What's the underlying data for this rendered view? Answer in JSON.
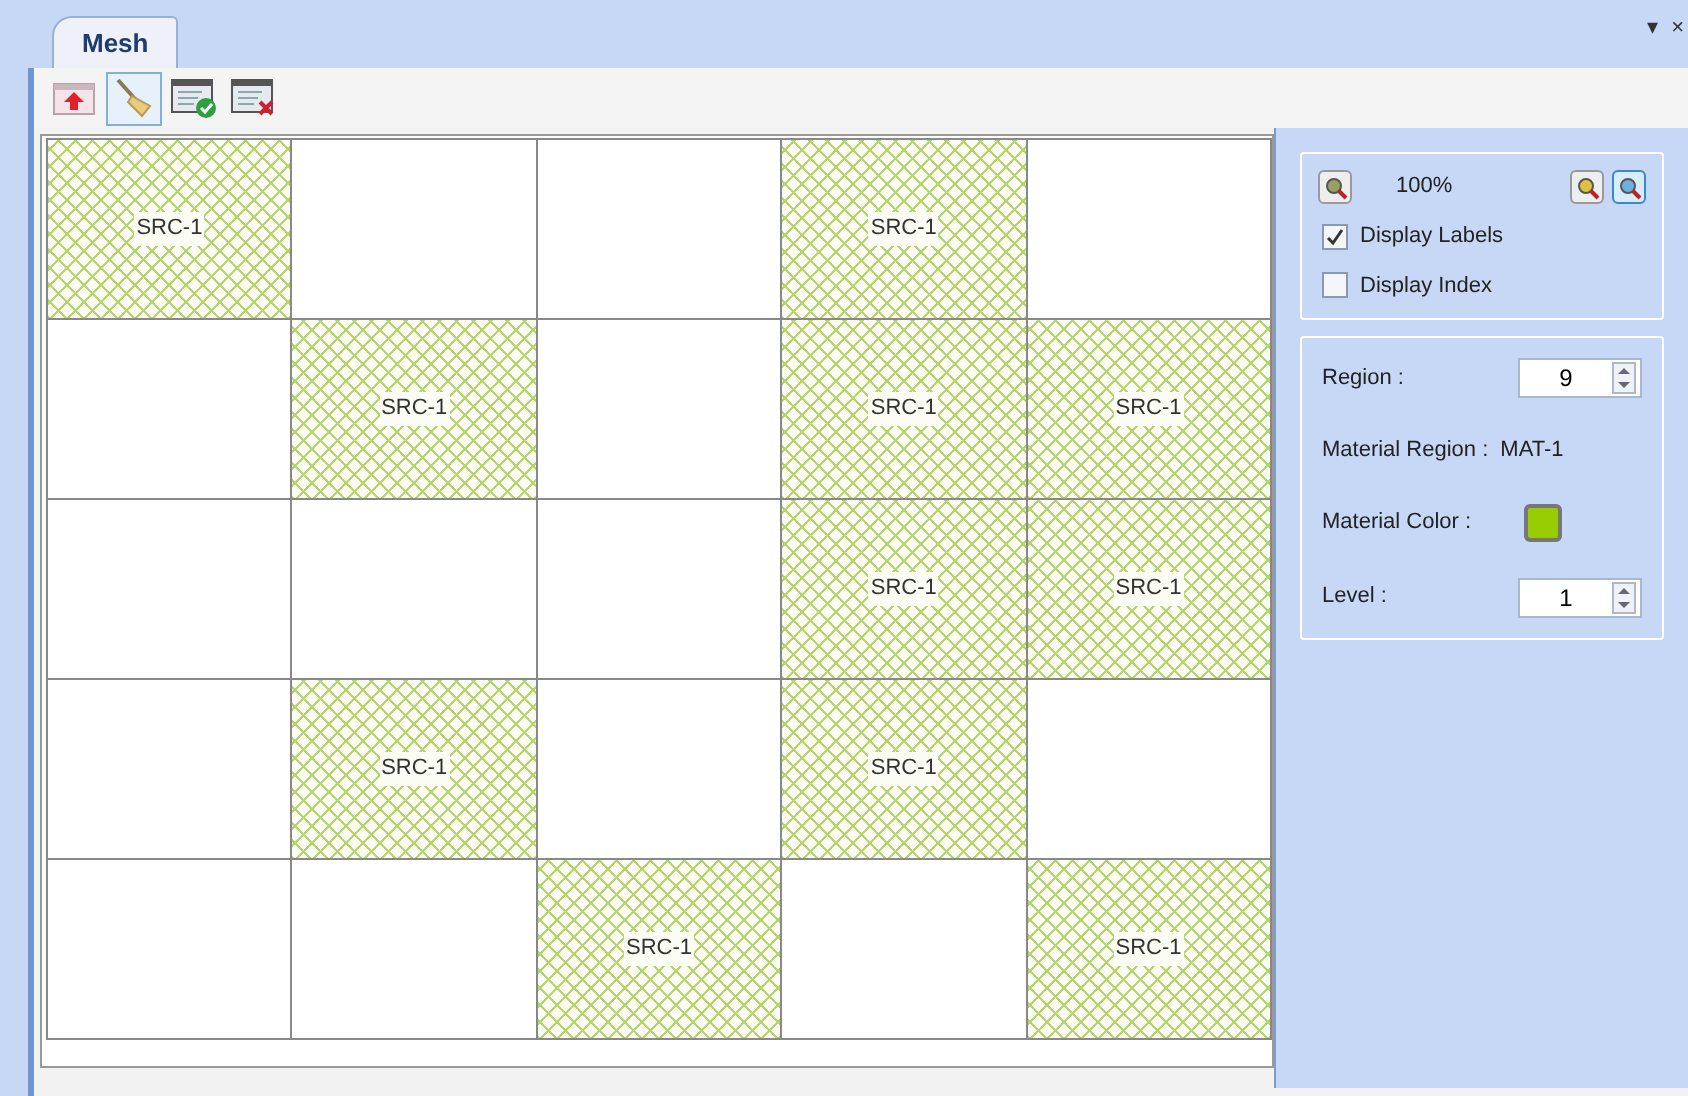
{
  "tabs": [
    {
      "label": "Mesh",
      "selected": true
    }
  ],
  "window_controls": [
    "▾",
    "×"
  ],
  "toolbar": [
    {
      "kind": "import",
      "selected": false
    },
    {
      "kind": "brush",
      "selected": true
    },
    {
      "kind": "accept",
      "selected": false
    },
    {
      "kind": "cancel",
      "selected": false
    }
  ],
  "grid": {
    "rows": [
      [
        {
          "filled": true,
          "label": "SRC-1"
        },
        {
          "filled": false
        },
        {
          "filled": false
        },
        {
          "filled": true,
          "label": "SRC-1"
        },
        {
          "filled": false
        }
      ],
      [
        {
          "filled": false
        },
        {
          "filled": true,
          "label": "SRC-1"
        },
        {
          "filled": false
        },
        {
          "filled": true,
          "label": "SRC-1"
        },
        {
          "filled": true,
          "label": "SRC-1"
        }
      ],
      [
        {
          "filled": false
        },
        {
          "filled": false
        },
        {
          "filled": false
        },
        {
          "filled": true,
          "label": "SRC-1"
        },
        {
          "filled": true,
          "label": "SRC-1"
        }
      ],
      [
        {
          "filled": false
        },
        {
          "filled": true,
          "label": "SRC-1"
        },
        {
          "filled": false
        },
        {
          "filled": true,
          "label": "SRC-1"
        },
        {
          "filled": false
        }
      ],
      [
        {
          "filled": false
        },
        {
          "filled": false
        },
        {
          "filled": true,
          "label": "SRC-1"
        },
        {
          "filled": false
        },
        {
          "filled": true,
          "label": "SRC-1"
        }
      ]
    ]
  },
  "view": {
    "zoom": "100%",
    "zoom_buttons": [
      {
        "kind": "zoom_out",
        "selected": false
      },
      {
        "kind": "zoom_in",
        "selected": false
      },
      {
        "kind": "zoom_fit",
        "selected": true
      }
    ],
    "options": [
      {
        "label": "Display Labels",
        "checked": true
      },
      {
        "label": "Display Index",
        "checked": false
      }
    ]
  },
  "properties": {
    "region_label": "Region :",
    "region": "9",
    "material_region_label": "Material Region :",
    "material_region": "MAT-1",
    "material_color_label": "Material Color :",
    "swatch": {
      "color": "#99cc00"
    },
    "level_label": "Level :",
    "level": "1"
  }
}
